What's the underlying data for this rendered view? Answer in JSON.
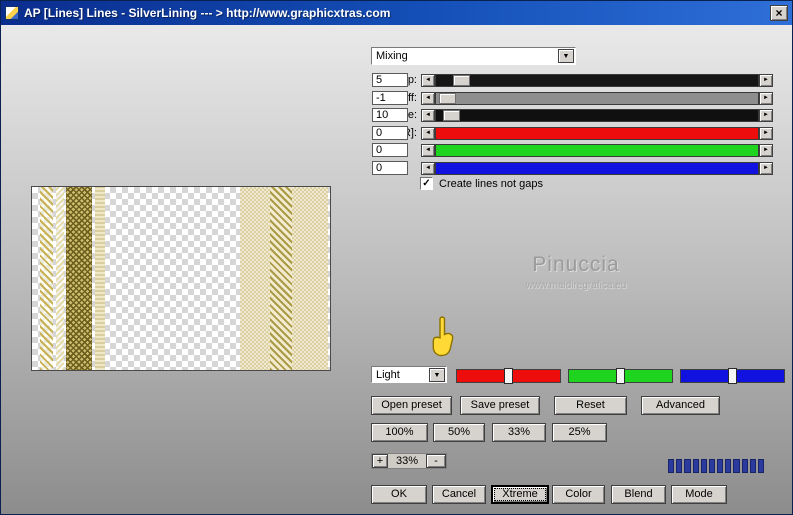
{
  "titlebar": {
    "title": "AP [Lines]  Lines - SilverLining    --- > http://www.graphicxtras.com",
    "close": "×"
  },
  "icons": {
    "left_arrow": "◄",
    "right_arrow": "►",
    "down_arrow": "▼",
    "check": "✓"
  },
  "mixing": {
    "value": "Mixing"
  },
  "sliders": {
    "rows": [
      {
        "label": "Gap:",
        "value": "5"
      },
      {
        "label": "Cutoff:",
        "value": "-1"
      },
      {
        "label": "Line:",
        "value": "10"
      },
      {
        "label": "Color[R]:",
        "value": "0"
      },
      {
        "label": "",
        "value": "0"
      },
      {
        "label": "",
        "value": "0"
      }
    ]
  },
  "options": {
    "create_lines_label": "Create lines not gaps",
    "checked": true
  },
  "watermark": {
    "name": "Pinuccia",
    "site": "www.maidiregrafica.eu"
  },
  "light": {
    "value": "Light"
  },
  "presets": {
    "open": "Open preset",
    "save": "Save preset",
    "reset": "Reset",
    "advanced": "Advanced"
  },
  "zoom_buttons": {
    "z100": "100%",
    "z50": "50%",
    "z33": "33%",
    "z25": "25%"
  },
  "zoom_control": {
    "plus": "+",
    "level": "33%",
    "minus": "-"
  },
  "actions": {
    "ok": "OK",
    "cancel": "Cancel",
    "xtreme": "Xtreme",
    "color": "Color",
    "blend": "Blend",
    "mode": "Mode"
  },
  "colors": {
    "titlebar_blue": "#1450b8",
    "slider_red": "#ee0d0d",
    "slider_green": "#1ed41e",
    "slider_blue": "#1212e0",
    "progress_blue": "#2b3a9e"
  }
}
